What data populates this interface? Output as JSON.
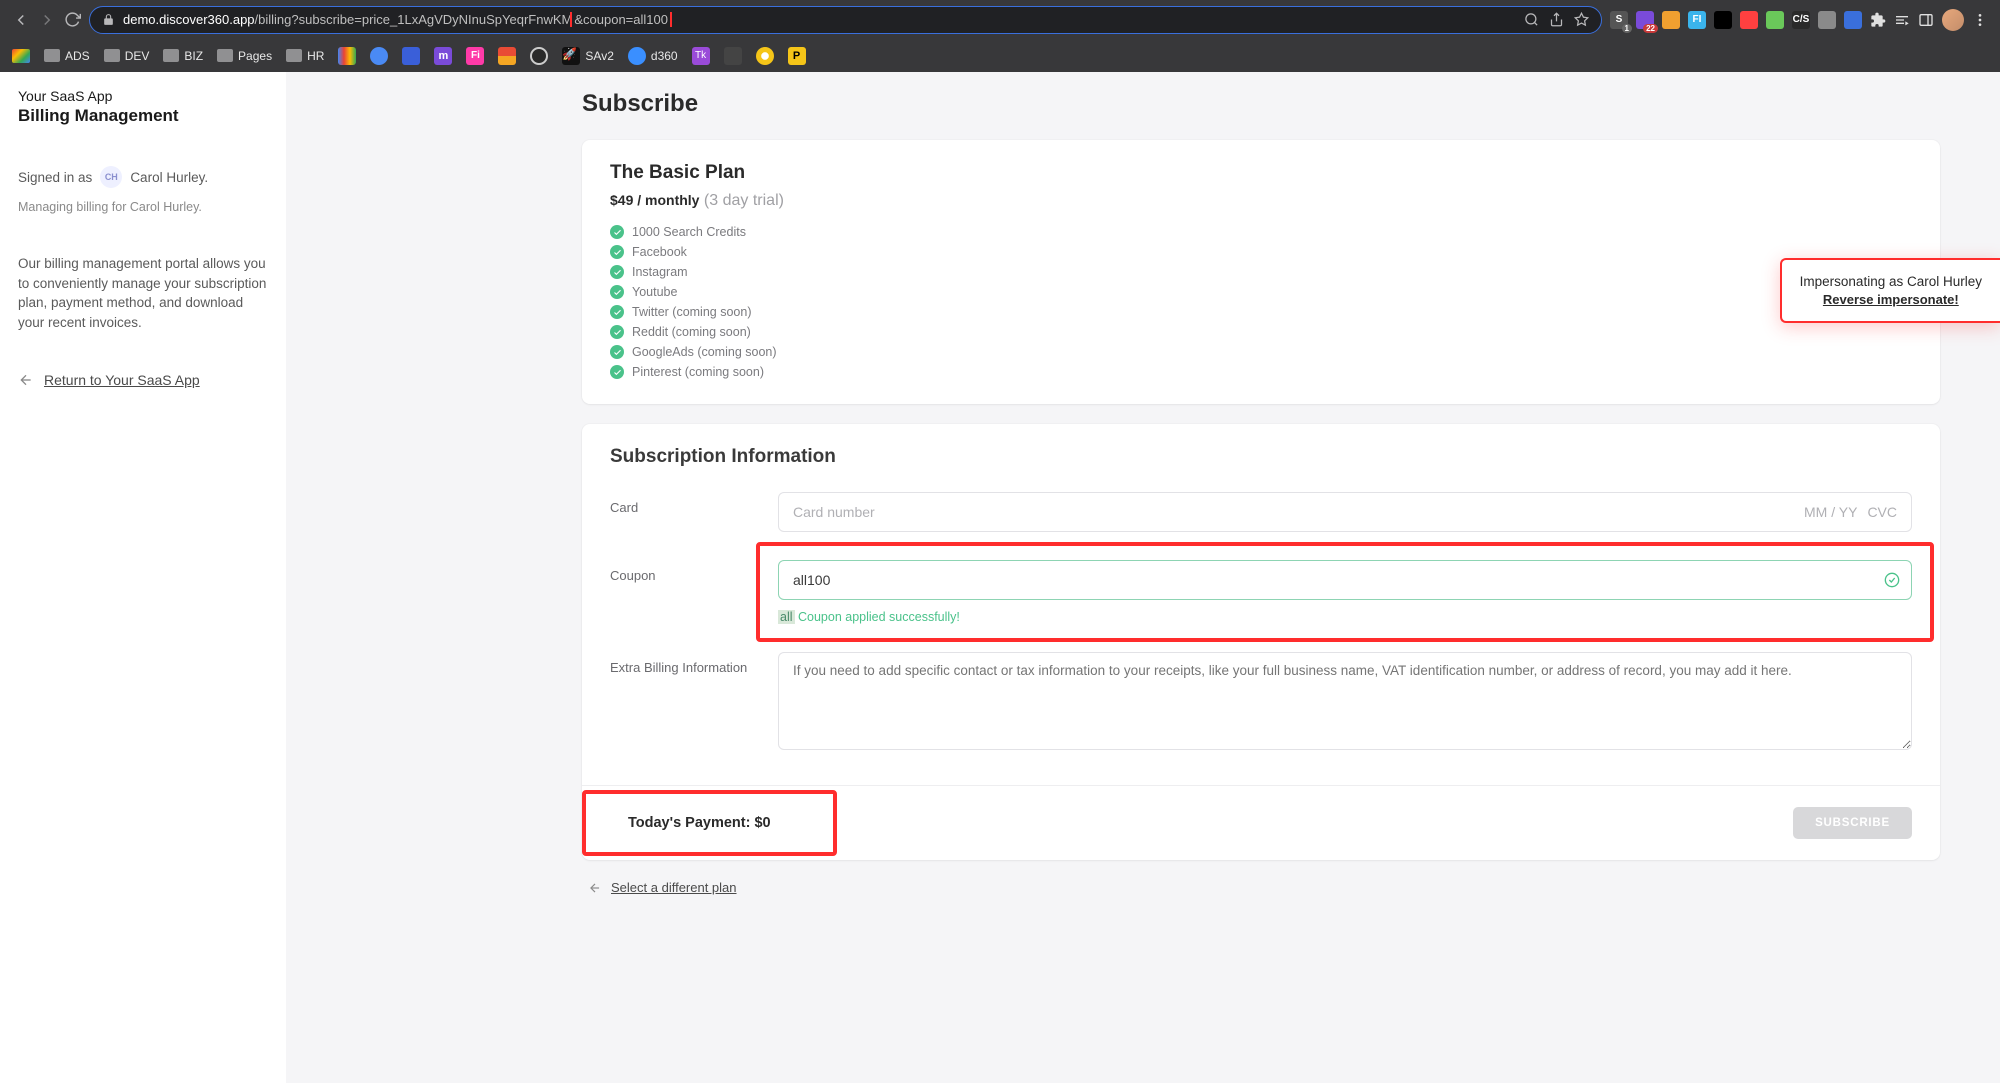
{
  "browser": {
    "url_domain": "demo.discover360.app",
    "url_rest": "/billing?subscribe=price_1LxAgVDyNInuSpYeqrFnwKM",
    "url_highlighted": "&coupon=all100",
    "bookmarks": [
      "ADS",
      "DEV",
      "BIZ",
      "Pages",
      "HR",
      "SAv2",
      "d360"
    ]
  },
  "ext_icons": [
    {
      "bg": "#555",
      "label": "S",
      "badge": "1"
    },
    {
      "bg": "#7a4bd9",
      "label": "",
      "badge": "22"
    },
    {
      "bg": "#f0a030",
      "label": ""
    },
    {
      "bg": "#3ab4ec",
      "label": "FI"
    },
    {
      "bg": "#000",
      "label": ""
    },
    {
      "bg": "#ff4040",
      "label": ""
    },
    {
      "bg": "#6ac85a",
      "label": ""
    },
    {
      "bg": "#2a2a2a",
      "label": "C/S"
    },
    {
      "bg": "#8a8a8a",
      "label": ""
    },
    {
      "bg": "#3a6fdc",
      "label": ""
    }
  ],
  "sidebar": {
    "app_name": "Your SaaS App",
    "page_name": "Billing Management",
    "signed_in_prefix": "Signed in as",
    "user_initials": "CH",
    "user_name": "Carol Hurley.",
    "managing_text": "Managing billing for Carol Hurley.",
    "portal_desc": "Our billing management portal allows you to conveniently manage your subscription plan, payment method, and download your recent invoices.",
    "return_label": "Return to Your SaaS App"
  },
  "main": {
    "title": "Subscribe",
    "plan": {
      "name": "The Basic Plan",
      "price": "$49 / monthly",
      "trial": "(3 day trial)",
      "features": [
        "1000 Search Credits",
        "Facebook",
        "Instagram",
        "Youtube",
        "Twitter (coming soon)",
        "Reddit (coming soon)",
        "GoogleAds (coming soon)",
        "Pinterest (coming soon)"
      ]
    },
    "subscription": {
      "section_title": "Subscription Information",
      "card_label": "Card",
      "card_number_ph": "Card number",
      "card_exp_ph": "MM / YY",
      "card_cvc_ph": "CVC",
      "coupon_label": "Coupon",
      "coupon_value": "all100",
      "coupon_tag": "all",
      "coupon_msg": "Coupon applied successfully!",
      "extra_label": "Extra Billing Information",
      "extra_ph": "If you need to add specific contact or tax information to your receipts, like your full business name, VAT identification number, or address of record, you may add it here."
    },
    "footer": {
      "payment_label": "Today's Payment: $0",
      "subscribe_btn": "SUBSCRIBE",
      "back_link": "Select a different plan"
    }
  },
  "toast": {
    "line1": "Impersonating as Carol Hurley",
    "line2": "Reverse impersonate!"
  }
}
